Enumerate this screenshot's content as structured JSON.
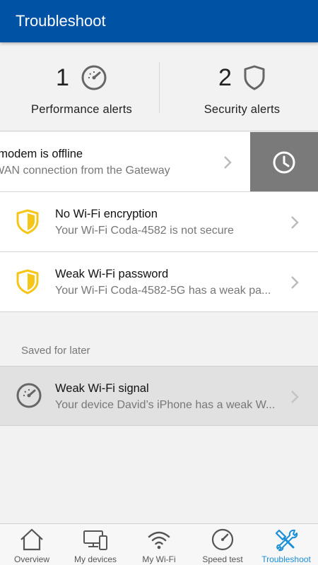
{
  "header": {
    "title": "Troubleshoot"
  },
  "summary": {
    "performance": {
      "count": "1",
      "label": "Performance alerts",
      "icon": "speedometer-icon"
    },
    "security": {
      "count": "2",
      "label": "Security alerts",
      "icon": "shield-icon"
    }
  },
  "alerts": [
    {
      "title": "ur modem is offline",
      "subtitle": "o WAN connection from the Gateway",
      "icon": "clock-icon",
      "swiped": true
    },
    {
      "title": "No Wi-Fi encryption",
      "subtitle": "Your Wi-Fi Coda-4582 is not secure",
      "icon": "warning-shield-icon"
    },
    {
      "title": "Weak Wi-Fi password",
      "subtitle": "Your Wi-Fi Coda-4582-5G has a weak pa...",
      "icon": "warning-shield-icon"
    }
  ],
  "saved": {
    "section_label": "Saved for later",
    "items": [
      {
        "title": "Weak Wi-Fi signal",
        "subtitle": "Your device David’s iPhone has a weak W...",
        "icon": "speedometer-icon"
      }
    ]
  },
  "tabs": [
    {
      "label": "Overview",
      "icon": "home-icon",
      "active": false
    },
    {
      "label": "My devices",
      "icon": "devices-icon",
      "active": false
    },
    {
      "label": "My Wi-Fi",
      "icon": "wifi-icon",
      "active": false
    },
    {
      "label": "Speed test",
      "icon": "speedometer-icon",
      "active": false
    },
    {
      "label": "Troubleshoot",
      "icon": "tools-icon",
      "active": true
    }
  ],
  "colors": {
    "header_bg": "#0052a5",
    "shield_warning": "#f5c518",
    "snooze_bg": "#7a7a7a",
    "active_tab": "#1a8fd8",
    "saved_row_bg": "#e1e1e1"
  }
}
